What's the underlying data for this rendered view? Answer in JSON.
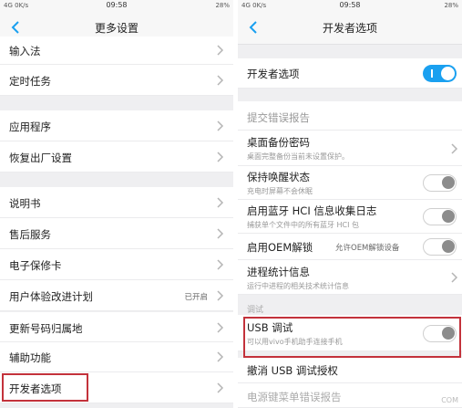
{
  "left": {
    "status": {
      "signal": "4G",
      "speed": "0K/s",
      "time": "09:58",
      "battery": "28%"
    },
    "title": "更多设置",
    "items": [
      {
        "label": "输入法"
      },
      {
        "label": "定时任务"
      },
      {
        "label": "应用程序"
      },
      {
        "label": "恢复出厂设置"
      },
      {
        "label": "说明书"
      },
      {
        "label": "售后服务"
      },
      {
        "label": "电子保修卡"
      },
      {
        "label": "用户体验改进计划",
        "value": "已开启"
      },
      {
        "label": "更新号码归属地"
      },
      {
        "label": "辅助功能"
      },
      {
        "label": "开发者选项"
      }
    ]
  },
  "right": {
    "status": {
      "signal": "4G",
      "speed": "0K/s",
      "time": "09:58",
      "battery": "28%"
    },
    "title": "开发者选项",
    "master": {
      "label": "开发者选项",
      "state": "on"
    },
    "items": [
      {
        "label": "提交错误报告"
      },
      {
        "label": "桌面备份密码",
        "sub": "桌面完整备份当前未设置保护。"
      },
      {
        "label": "保持唤醒状态",
        "sub": "充电时屏幕不会休眠",
        "state": "off"
      },
      {
        "label": "启用蓝牙 HCI 信息收集日志",
        "sub": "捕获单个文件中的所有蓝牙 HCI 包",
        "state": "off"
      },
      {
        "label": "启用OEM解锁",
        "value": "允许OEM解锁设备",
        "state": "off"
      },
      {
        "label": "进程统计信息",
        "sub": "运行中进程的相关技术统计信息"
      },
      {
        "section": "调试"
      },
      {
        "label": "USB 调试",
        "sub": "可以用vivo手机助手连接手机",
        "state": "off"
      },
      {
        "label": "撤消 USB 调试授权"
      },
      {
        "label": "电源键菜单错误报告"
      }
    ],
    "watermark": "COM"
  },
  "colors": {
    "accent": "#1aa0f0",
    "highlight": "#c3323b"
  }
}
